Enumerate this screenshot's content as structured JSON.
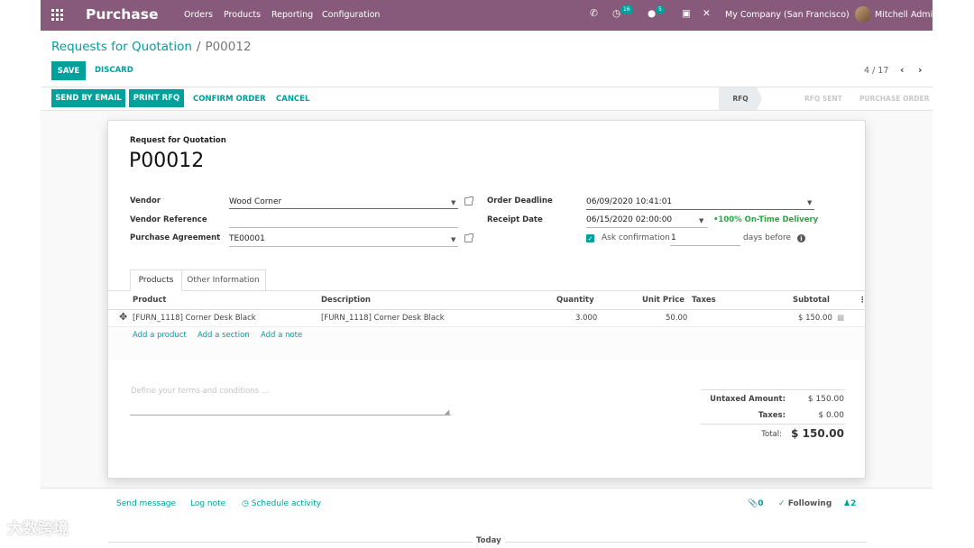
{
  "navbar": {
    "app_name": "Purchase",
    "menu": [
      "Orders",
      "Products",
      "Reporting",
      "Configuration"
    ],
    "activity_count": "16",
    "message_count": "5",
    "company": "My Company (San Francisco)",
    "user": "Mitchell Admin"
  },
  "breadcrumb": {
    "parent": "Requests for Quotation",
    "separator": "/",
    "current": "P00012"
  },
  "form_buttons": {
    "save": "SAVE",
    "discard": "DISCARD"
  },
  "pager": {
    "value": "4 / 17"
  },
  "header_buttons": {
    "send_email": "SEND BY EMAIL",
    "print_rfq": "PRINT RFQ",
    "confirm": "CONFIRM ORDER",
    "cancel": "CANCEL"
  },
  "stages": [
    "RFQ",
    "RFQ SENT",
    "PURCHASE ORDER"
  ],
  "record": {
    "title_label": "Request for Quotation",
    "name": "P00012",
    "vendor_label": "Vendor",
    "vendor": "Wood Corner",
    "vendor_ref_label": "Vendor Reference",
    "vendor_ref": "",
    "agreement_label": "Purchase Agreement",
    "agreement": "TE00001",
    "deadline_label": "Order Deadline",
    "deadline": "06/09/2020 10:41:01",
    "receipt_label": "Receipt Date",
    "receipt": "06/15/2020 02:00:00",
    "on_time": "•100% On-Time Delivery",
    "ask_confirmation": "Ask confirmation",
    "ask_days": "1",
    "days_before": "days before"
  },
  "tabs": [
    "Products",
    "Other Information"
  ],
  "lines": {
    "headers": {
      "product": "Product",
      "description": "Description",
      "quantity": "Quantity",
      "unit_price": "Unit Price",
      "taxes": "Taxes",
      "subtotal": "Subtotal"
    },
    "rows": [
      {
        "product": "[FURN_1118] Corner Desk Black",
        "description": "[FURN_1118] Corner Desk Black",
        "quantity": "3.000",
        "unit_price": "50.00",
        "taxes": "",
        "subtotal": "$ 150.00"
      }
    ],
    "add_product": "Add a product",
    "add_section": "Add a section",
    "add_note": "Add a note"
  },
  "notes_placeholder": "Define your terms and conditions ...",
  "totals": {
    "untaxed_label": "Untaxed Amount:",
    "untaxed": "$ 150.00",
    "taxes_label": "Taxes:",
    "taxes": "$ 0.00",
    "total_label": "Total:",
    "total": "$ 150.00"
  },
  "chatter": {
    "send_message": "Send message",
    "log_note": "Log note",
    "schedule_activity": "Schedule activity",
    "attachments": "0",
    "following": "Following",
    "followers": "2",
    "today": "Today"
  },
  "watermark": "大数跨境",
  "colors": {
    "navbar": "#875a7b",
    "accent": "#00a09d",
    "success": "#28a745"
  }
}
